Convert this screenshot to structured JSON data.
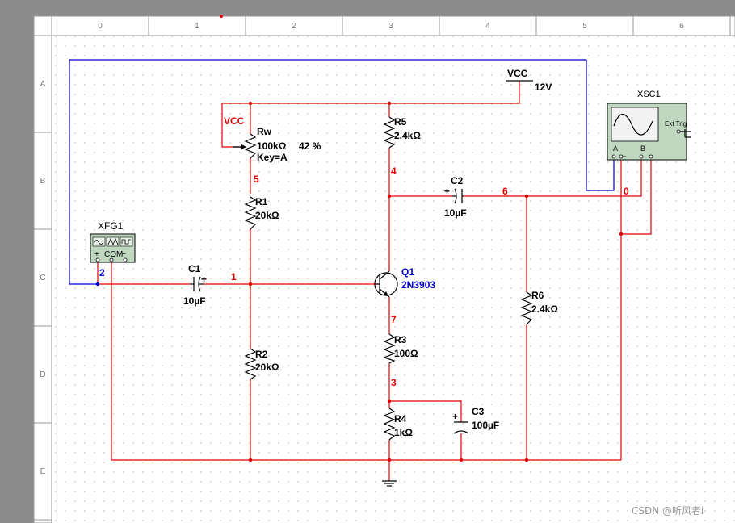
{
  "rulers": {
    "columns": [
      "0",
      "1",
      "2",
      "3",
      "4",
      "5",
      "6"
    ],
    "rows": [
      "A",
      "B",
      "C",
      "D",
      "E"
    ]
  },
  "vcc_source": {
    "label": "VCC",
    "value": "12V"
  },
  "vcc_local": {
    "label": "VCC"
  },
  "xfg1": {
    "label": "XFG1",
    "com": "COM",
    "plus": "+",
    "minus": "−"
  },
  "xsc1": {
    "label": "XSC1",
    "ext_trig": "Ext Trig",
    "a": "A",
    "b": "B",
    "a_sign": "_",
    "b_sign": "_"
  },
  "components": {
    "rw": {
      "ref": "Rw",
      "value": "100kΩ",
      "percent": "42 %",
      "key": "Key=A"
    },
    "r1": {
      "ref": "R1",
      "value": "20kΩ"
    },
    "r2": {
      "ref": "R2",
      "value": "20kΩ"
    },
    "r3": {
      "ref": "R3",
      "value": "100Ω"
    },
    "r4": {
      "ref": "R4",
      "value": "1kΩ"
    },
    "r5": {
      "ref": "R5",
      "value": "2.4kΩ"
    },
    "r6": {
      "ref": "R6",
      "value": "2.4kΩ"
    },
    "c1": {
      "ref": "C1",
      "value": "10µF"
    },
    "c2": {
      "ref": "C2",
      "value": "10µF"
    },
    "c3": {
      "ref": "C3",
      "value": "100µF"
    },
    "q1": {
      "ref": "Q1",
      "value": "2N3903"
    }
  },
  "nets": {
    "n0": "0",
    "n1": "1",
    "n2": "2",
    "n3": "3",
    "n4": "4",
    "n5": "5",
    "n6": "6",
    "n7": "7"
  },
  "cap_plus": "+",
  "watermark": "CSDN @听风者i",
  "colors": {
    "wire": "#e00000",
    "wire_scope": "#0000cc",
    "sheet": "#ffffff",
    "grid_dot": "#b0b0b0"
  }
}
